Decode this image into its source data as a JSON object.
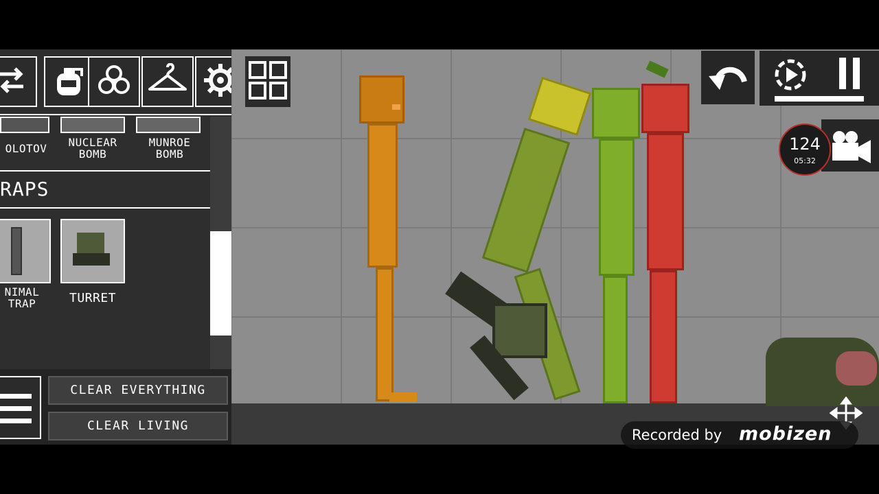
{
  "toolbar": {
    "icons": [
      "swap-arrows-icon",
      "grenade-icon",
      "biohazard-icon",
      "hanger-icon",
      "gear-icon"
    ]
  },
  "categories": {
    "explosives": {
      "items": [
        {
          "label": "OLOTOV"
        },
        {
          "label": "NUCLEAR\nBOMB"
        },
        {
          "label": "MUNROE\nBOMB"
        }
      ]
    },
    "traps": {
      "title": "RAPS",
      "items": [
        {
          "label": "NIMAL\nTRAP"
        },
        {
          "label": "TURRET"
        }
      ]
    }
  },
  "actions": {
    "clear_everything": "CLEAR EVERYTHING",
    "clear_living": "CLEAR LIVING"
  },
  "hud": {
    "record_overlay_top": "124",
    "record_overlay_bottom": "05:32",
    "recorded_by": "Recorded by",
    "recorder_brand": "mobizen"
  },
  "colors": {
    "orange_melon": "#d78a1a",
    "yellow_melon": "#c9c22a",
    "green_melon": "#7fae2b",
    "red_melon": "#cf3a31",
    "turret": "#4f5a38"
  }
}
